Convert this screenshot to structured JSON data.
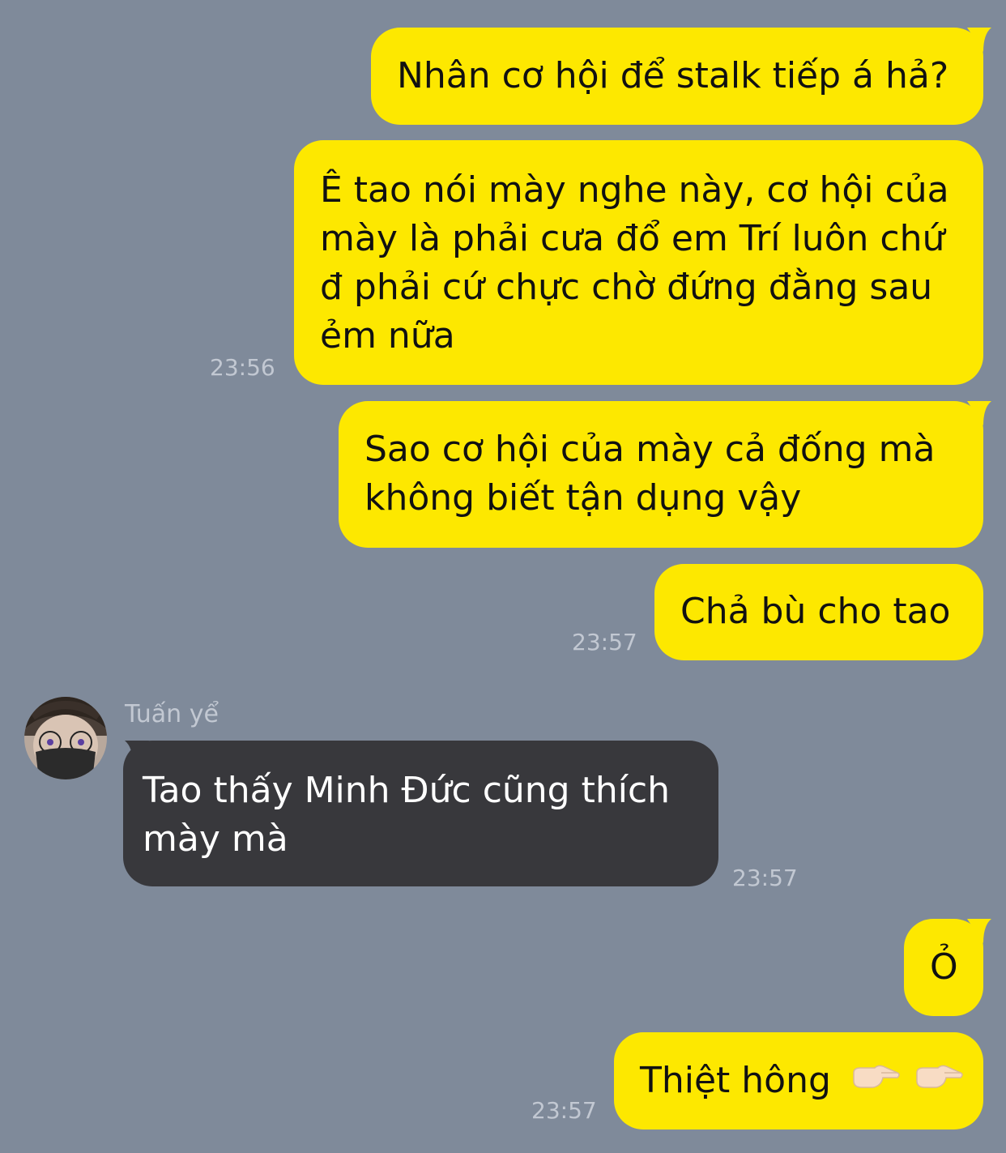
{
  "colors": {
    "background": "#7f8a9a",
    "outgoing_bubble": "#fde800",
    "incoming_bubble": "#38383c",
    "timestamp": "#c2c8d2"
  },
  "messages": [
    {
      "direction": "outgoing",
      "lines": [
        "Nhân cơ hội để stalk tiếp á hả?"
      ],
      "time": ""
    },
    {
      "direction": "outgoing",
      "lines": [
        "Ê tao nói mày nghe này, cơ hội của",
        "mày là phải cưa đổ em Trí luôn chứ",
        "đ phải cứ chực chờ đứng đằng sau",
        "ẻm nữa"
      ],
      "time": "23:56"
    },
    {
      "direction": "outgoing",
      "lines": [
        "Sao cơ hội của mày cả đống mà",
        "không biết tận dụng vậy"
      ],
      "time": ""
    },
    {
      "direction": "outgoing",
      "lines": [
        "Chả bù cho tao"
      ],
      "time": "23:57"
    },
    {
      "direction": "incoming",
      "sender": "Tuấn yể",
      "lines": [
        "Tao thấy Minh Đức cũng thích",
        "mày mà"
      ],
      "time": "23:57"
    },
    {
      "direction": "outgoing",
      "lines": [
        "Ỏ"
      ],
      "time": ""
    },
    {
      "direction": "outgoing",
      "lines": [
        "Thiệt hông"
      ],
      "emoji": [
        "pointing-right-hand-icon",
        "pointing-right-hand-icon"
      ],
      "time": "23:57"
    }
  ]
}
